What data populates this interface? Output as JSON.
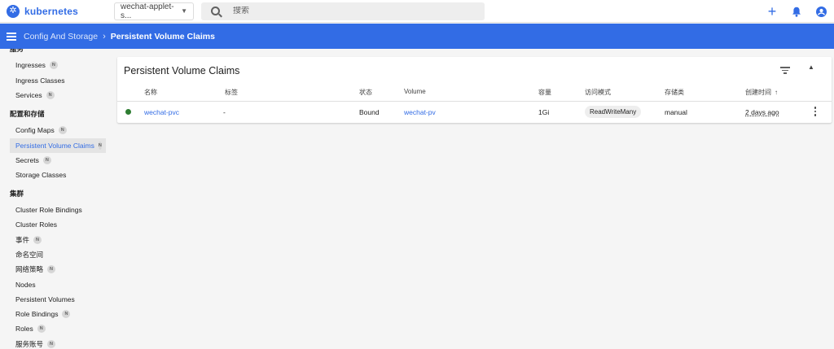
{
  "app": {
    "title": "kubernetes"
  },
  "topbar": {
    "namespace": "wechat-applet-s...",
    "search_placeholder": "搜索",
    "add_glyph": "+",
    "colors": {
      "brand": "#326ce5"
    }
  },
  "breadcrumb": {
    "parent": "Config And Storage",
    "current": "Persistent Volume Claims"
  },
  "sidebar": {
    "top_section": "服务",
    "items_service": [
      {
        "label": "Ingresses",
        "badge": "N"
      },
      {
        "label": "Ingress Classes",
        "badge": ""
      },
      {
        "label": "Services",
        "badge": "N"
      }
    ],
    "config_section": "配置和存储",
    "items_config": [
      {
        "label": "Config Maps",
        "badge": "N"
      },
      {
        "label": "Persistent Volume Claims",
        "badge": "N",
        "active": true
      },
      {
        "label": "Secrets",
        "badge": "N"
      },
      {
        "label": "Storage Classes",
        "badge": ""
      }
    ],
    "cluster_section": "集群",
    "items_cluster": [
      {
        "label": "Cluster Role Bindings",
        "badge": ""
      },
      {
        "label": "Cluster Roles",
        "badge": ""
      },
      {
        "label": "事件",
        "badge": "N"
      },
      {
        "label": "命名空间",
        "badge": ""
      },
      {
        "label": "网络策略",
        "badge": "N"
      },
      {
        "label": "Nodes",
        "badge": ""
      },
      {
        "label": "Persistent Volumes",
        "badge": ""
      },
      {
        "label": "Role Bindings",
        "badge": "N"
      },
      {
        "label": "Roles",
        "badge": "N"
      },
      {
        "label": "服务账号",
        "badge": "N"
      }
    ]
  },
  "card": {
    "title": "Persistent Volume Claims",
    "columns": [
      "名称",
      "标签",
      "状态",
      "Volume",
      "容量",
      "访问模式",
      "存储类",
      "创建时间"
    ],
    "sort_arrow": "↑",
    "rows": [
      {
        "status_color": "#2e7d32",
        "name": "wechat-pvc",
        "labels": "-",
        "status": "Bound",
        "volume": "wechat-pv",
        "capacity": "1Gi",
        "access_mode": "ReadWriteMany",
        "storage_class": "manual",
        "created": "2 days ago"
      }
    ]
  }
}
